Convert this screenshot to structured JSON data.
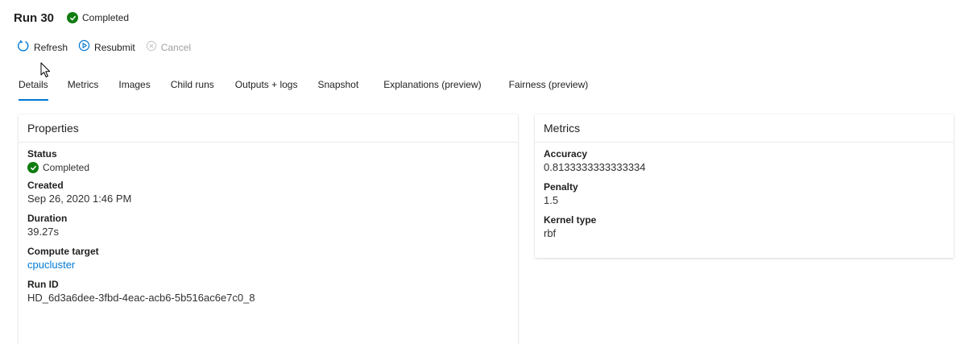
{
  "header": {
    "title": "Run 30",
    "status": "Completed"
  },
  "toolbar": {
    "refresh": "Refresh",
    "resubmit": "Resubmit",
    "cancel": "Cancel"
  },
  "tabs": [
    {
      "label": "Details",
      "active": true
    },
    {
      "label": "Metrics"
    },
    {
      "label": "Images"
    },
    {
      "label": "Child runs"
    },
    {
      "label": "Outputs + logs"
    },
    {
      "label": "Snapshot"
    },
    {
      "label": "Explanations (preview)"
    },
    {
      "label": "Fairness (preview)"
    }
  ],
  "properties": {
    "title": "Properties",
    "status_label": "Status",
    "status_value": "Completed",
    "created_label": "Created",
    "created_value": "Sep 26, 2020 1:46 PM",
    "duration_label": "Duration",
    "duration_value": "39.27s",
    "compute_label": "Compute target",
    "compute_value": "cpucluster",
    "runid_label": "Run ID",
    "runid_value": "HD_6d3a6dee-3fbd-4eac-acb6-5b516ac6e7c0_8"
  },
  "metrics": {
    "title": "Metrics",
    "accuracy_label": "Accuracy",
    "accuracy_value": "0.8133333333333334",
    "penalty_label": "Penalty",
    "penalty_value": "1.5",
    "kernel_label": "Kernel type",
    "kernel_value": "rbf"
  },
  "colors": {
    "accent": "#0078d4",
    "success": "#107c10"
  }
}
